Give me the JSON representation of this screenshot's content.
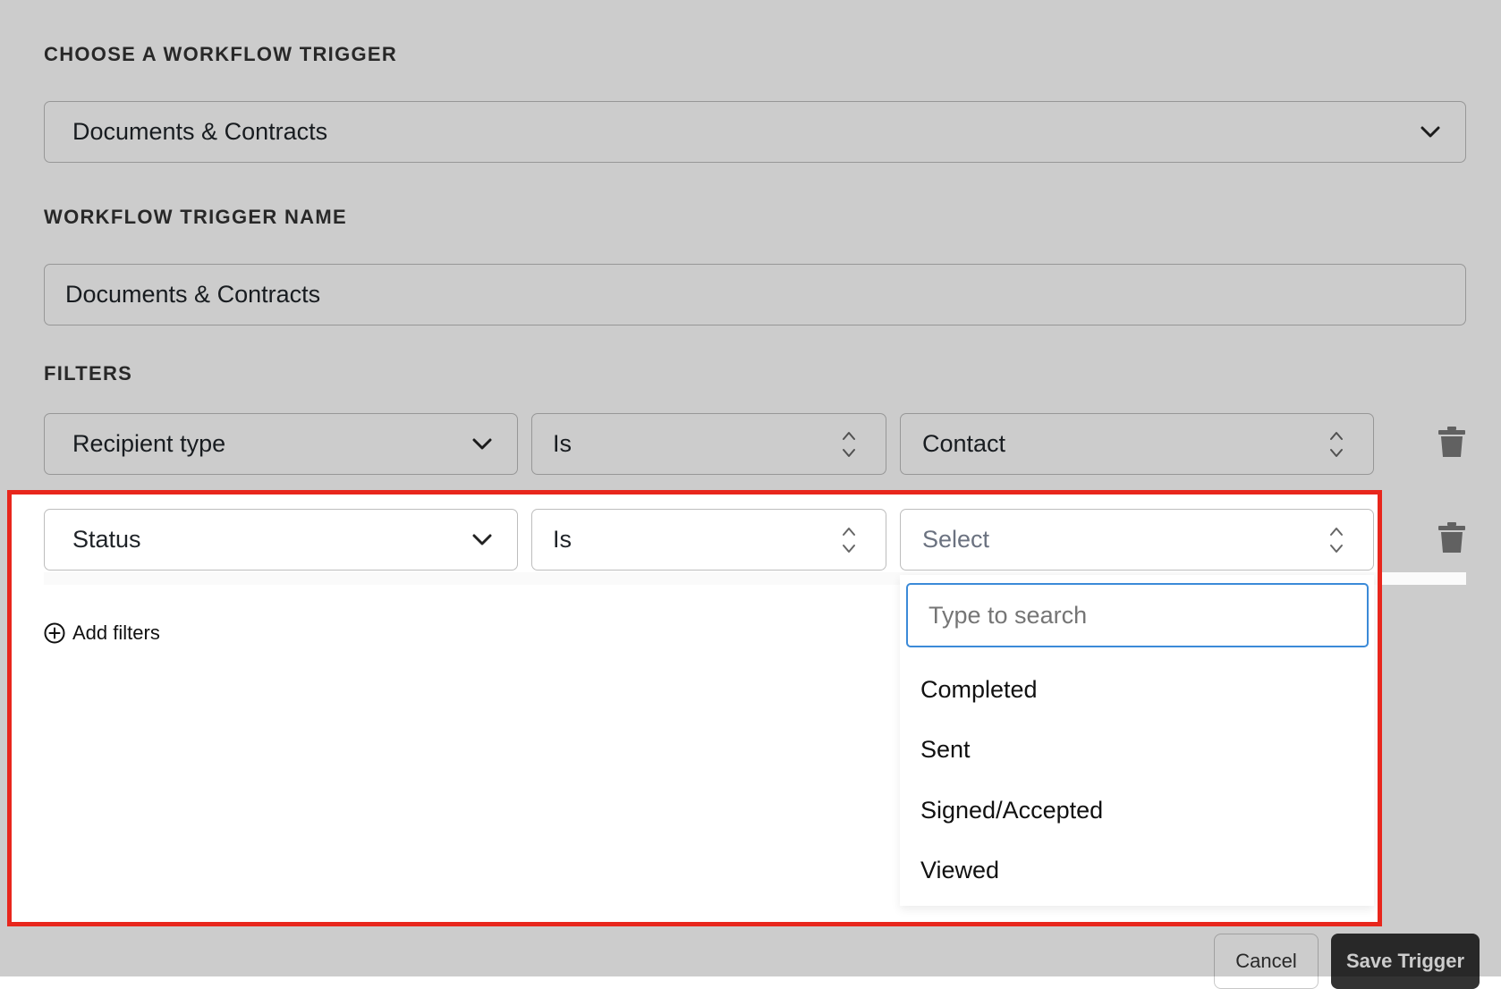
{
  "trigger_section": {
    "label": "CHOOSE A WORKFLOW TRIGGER",
    "selected": "Documents & Contracts"
  },
  "name_section": {
    "label": "WORKFLOW TRIGGER NAME",
    "value": "Documents & Contracts"
  },
  "filters_section": {
    "label": "FILTERS",
    "rows": [
      {
        "field": "Recipient type",
        "operator": "Is",
        "value": "Contact"
      },
      {
        "field": "Status",
        "operator": "Is",
        "value_placeholder": "Select"
      }
    ],
    "add_filters_label": "Add filters"
  },
  "dropdown": {
    "search_placeholder": "Type to search",
    "options": [
      "Completed",
      "Sent",
      "Signed/Accepted",
      "Viewed"
    ]
  },
  "footer": {
    "cancel_label": "Cancel",
    "save_label": "Save Trigger"
  },
  "colors": {
    "highlight_border": "#e8261c",
    "focus_border": "#3b8ad8",
    "save_button_bg": "#333333"
  },
  "icons": [
    "chevron-down-icon",
    "up-down-arrows-icon",
    "trash-icon",
    "plus-circle-icon"
  ]
}
